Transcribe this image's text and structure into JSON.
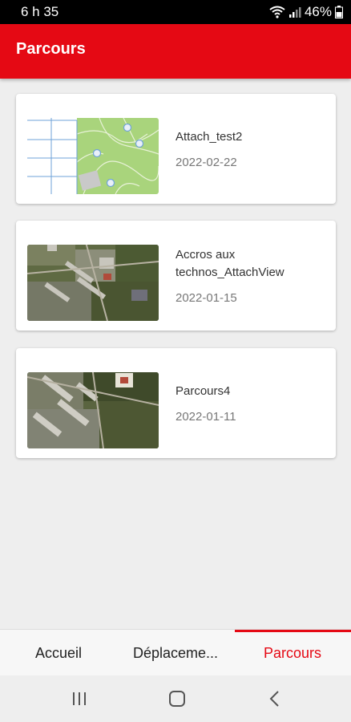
{
  "status_bar": {
    "time": "6 h 35",
    "battery": "46%",
    "icons": [
      "wifi-icon",
      "signal-icon",
      "battery-icon"
    ]
  },
  "app_bar": {
    "title": "Parcours",
    "color": "#e50914"
  },
  "parcours": [
    {
      "title": "Attach_test2",
      "date": "2022-02-22",
      "thumbnail": "map-thumbnail"
    },
    {
      "title": "Accros aux technos_AttachView",
      "date": "2022-01-15",
      "thumbnail": "satellite-thumbnail"
    },
    {
      "title": "Parcours4",
      "date": "2022-01-11",
      "thumbnail": "satellite-thumbnail"
    }
  ],
  "bottom_nav": {
    "tabs": [
      {
        "label": "Accueil",
        "active": false
      },
      {
        "label": "Déplaceme...",
        "active": false
      },
      {
        "label": "Parcours",
        "active": true
      }
    ]
  },
  "system_nav": [
    "recent-apps-icon",
    "home-icon",
    "back-icon"
  ]
}
